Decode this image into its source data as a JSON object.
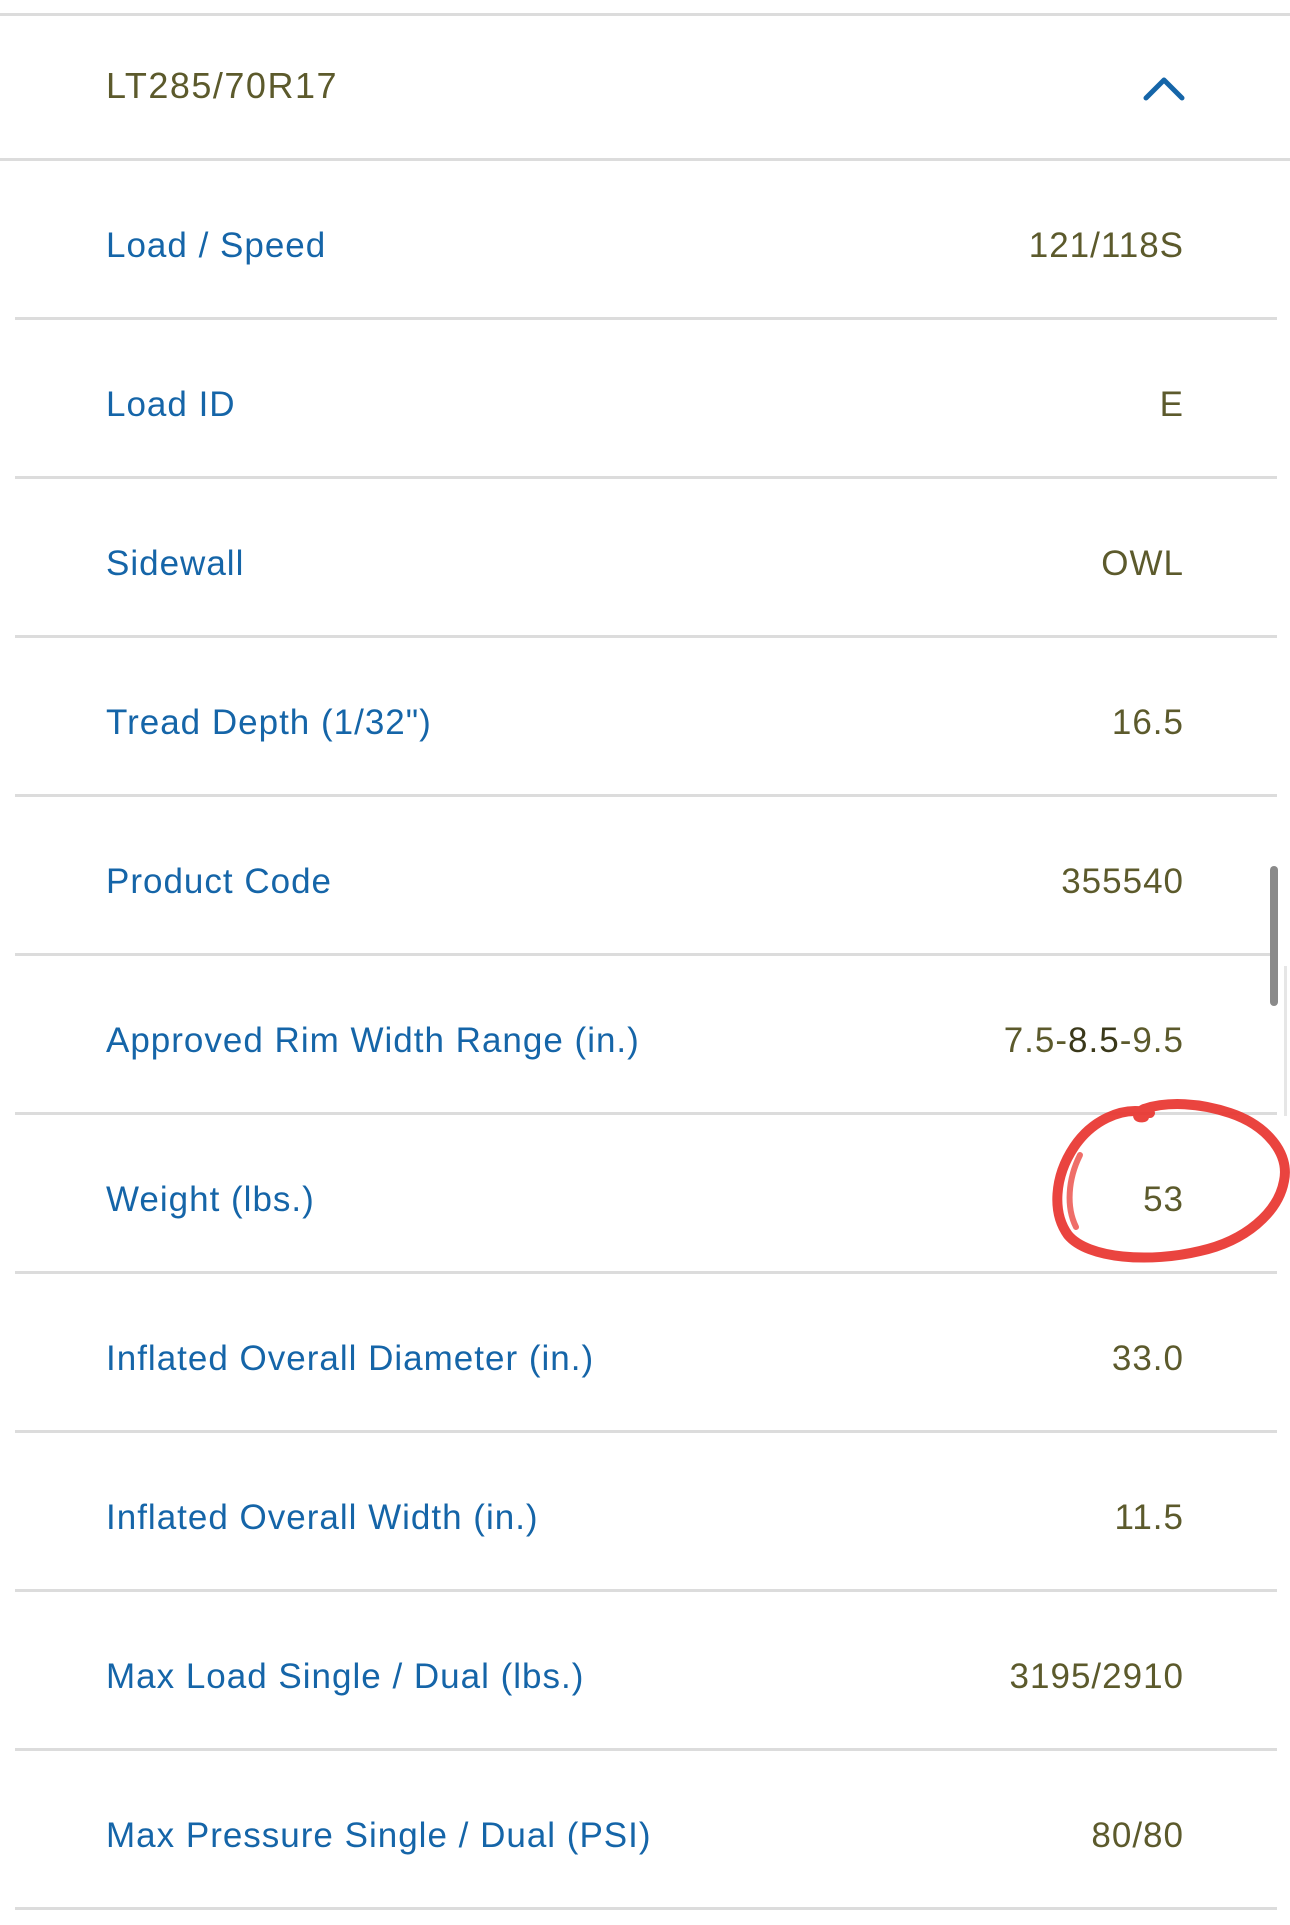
{
  "header": {
    "title": "LT285/70R17",
    "toggle_icon": "chevron-up-icon",
    "accent_color": "#1565a8"
  },
  "specs": [
    {
      "label": "Load / Speed",
      "value": "121/118S"
    },
    {
      "label": "Load ID",
      "value": "E"
    },
    {
      "label": "Sidewall",
      "value": "OWL"
    },
    {
      "label": "Tread Depth (1/32\")",
      "value": "16.5"
    },
    {
      "label": "Product Code",
      "value": "355540"
    },
    {
      "label": "Approved Rim Width Range (in.)",
      "value_parts": [
        "7.5-",
        "8.5",
        "-9.5"
      ]
    },
    {
      "label": "Weight (lbs.)",
      "value": "53"
    },
    {
      "label": "Inflated Overall Diameter (in.)",
      "value": "33.0"
    },
    {
      "label": "Inflated Overall Width (in.)",
      "value": "11.5"
    },
    {
      "label": "Max Load Single / Dual (lbs.)",
      "value": "3195/2910"
    },
    {
      "label": "Max Pressure Single / Dual (PSI)",
      "value": "80/80"
    }
  ],
  "colors": {
    "label": "#1565a8",
    "value": "#5c5a2c",
    "annotation": "#e8302a"
  }
}
